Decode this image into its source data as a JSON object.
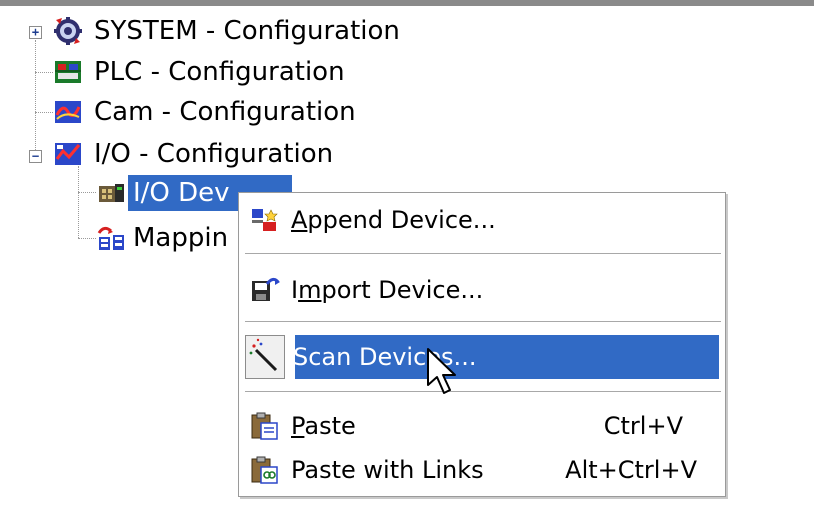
{
  "tree": {
    "items": [
      {
        "label": "SYSTEM - Configuration",
        "icon": "system-config-icon",
        "expander": "+"
      },
      {
        "label": "PLC - Configuration",
        "icon": "plc-config-icon"
      },
      {
        "label": "Cam - Configuration",
        "icon": "cam-config-icon"
      },
      {
        "label": "I/O - Configuration",
        "icon": "io-config-icon",
        "expander": "−"
      },
      {
        "label": "I/O Devices",
        "visible_label": "I/O Dev",
        "icon": "io-devices-icon",
        "selected": true
      },
      {
        "label": "Mappings",
        "visible_label": "Mappin",
        "icon": "mappings-icon"
      }
    ]
  },
  "context_menu": {
    "items": [
      {
        "pre": "",
        "accel": "A",
        "post": "ppend Device...",
        "icon": "append-device-icon",
        "shortcut": ""
      },
      {
        "pre": "I",
        "accel": "m",
        "post": "port Device...",
        "icon": "import-device-icon",
        "shortcut": ""
      },
      {
        "pre": "Scan Devices...",
        "accel": "",
        "post": "",
        "icon": "scan-wand-icon",
        "shortcut": "",
        "highlighted": true
      },
      {
        "pre": "",
        "accel": "P",
        "post": "aste",
        "icon": "paste-icon",
        "shortcut": "Ctrl+V"
      },
      {
        "pre": "Paste with Links",
        "accel": "",
        "post": "",
        "icon": "paste-links-icon",
        "shortcut": "Alt+Ctrl+V"
      }
    ]
  },
  "colors": {
    "selection": "#316ac5",
    "selection_text": "#ffffff",
    "menu_border": "#9a9a9a"
  }
}
